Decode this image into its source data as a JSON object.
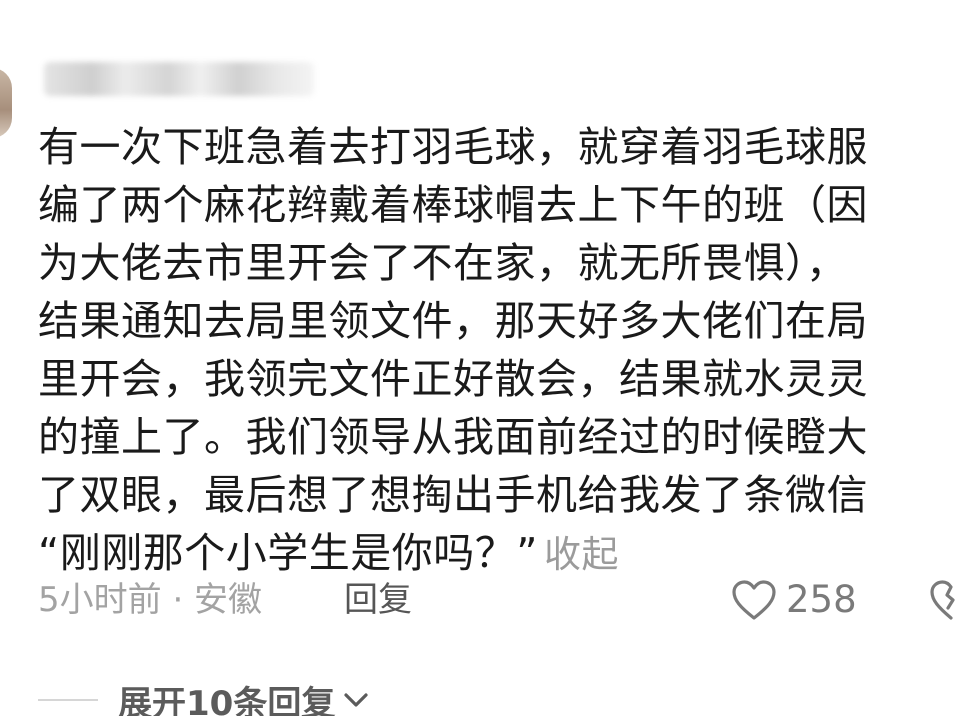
{
  "comment": {
    "username": "███ — █████",
    "lines": [
      "有一次下班急着去打羽毛球，就穿着羽毛球服",
      "编了两个麻花辫戴着棒球帽去上下午的班（因",
      "为大佬去市里开会了不在家，就无所畏惧），",
      "结果通知去局里领文件，那天好多大佬们在局",
      "里开会，我领完文件正好散会，结果就水灵灵",
      "的撞上了。我们领导从我面前经过的时候瞪大",
      "了双眼，最后想了想掏出手机给我发了条微信",
      "“刚刚那个小学生是你吗？”"
    ],
    "collapse_label": "收起",
    "meta": {
      "time_location": "5小时前 · 安徽",
      "reply_label": "回复",
      "like_count": "258"
    }
  },
  "replies": {
    "expand_label": "展开10条回复"
  },
  "icons": {
    "like": "heart-outline-icon",
    "dislike": "broken-heart-icon",
    "expand": "chevron-down-icon"
  },
  "colors": {
    "text": "#1a1a1a",
    "muted": "#a3a3a3",
    "secondary": "#565656"
  }
}
